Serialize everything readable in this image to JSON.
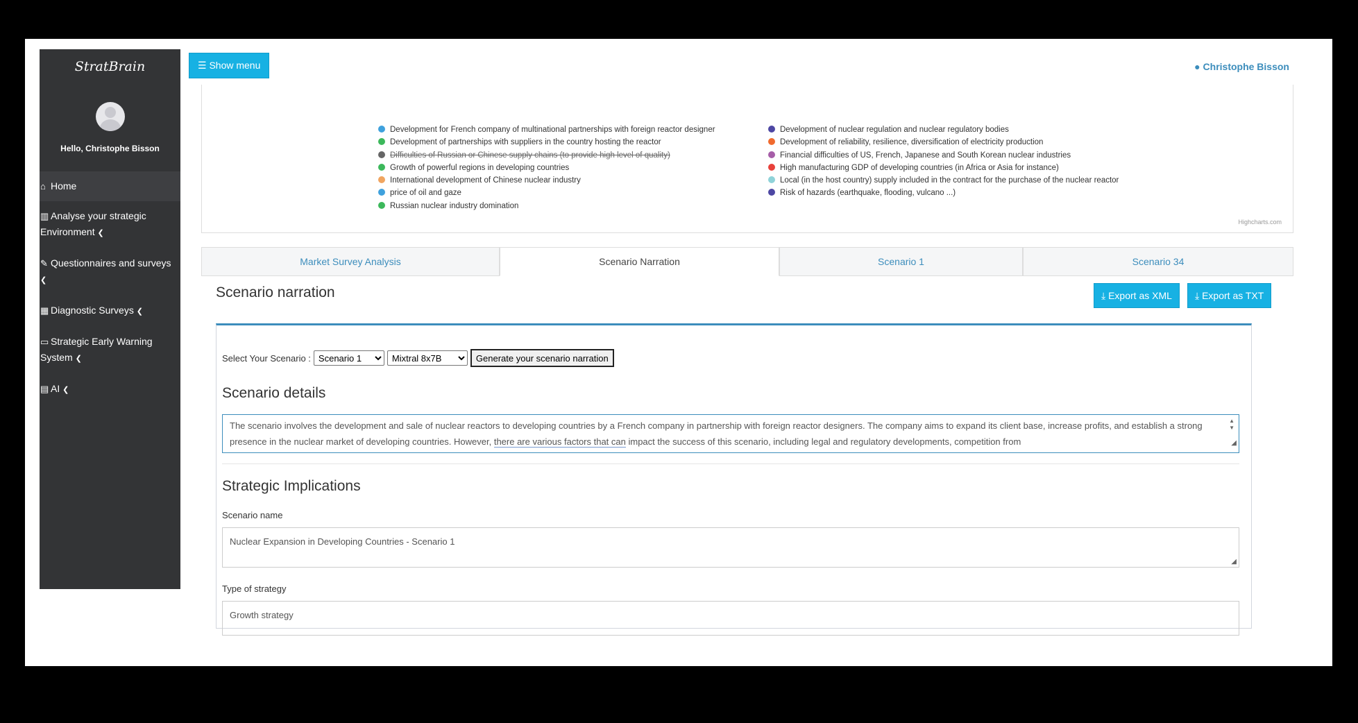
{
  "sidebar": {
    "brand": "StratBrain",
    "greeting": "Hello, Christophe Bisson",
    "items": [
      {
        "icon": "home-icon",
        "label": "Home"
      },
      {
        "icon": "chart-icon",
        "label": "Analyse your strategic Environment"
      },
      {
        "icon": "edit-icon",
        "label": "Questionnaires and surveys"
      },
      {
        "icon": "calendar-icon",
        "label": "Diagnostic Surveys"
      },
      {
        "icon": "laptop-icon",
        "label": "Strategic Early Warning System"
      },
      {
        "icon": "calculator-icon",
        "label": "AI"
      }
    ]
  },
  "header": {
    "show_menu": "Show menu",
    "user_name": "Christophe Bisson"
  },
  "legend": {
    "left": [
      {
        "label": "Development for French company of multinational partnerships with foreign reactor designer",
        "color": "#3fa1dd"
      },
      {
        "label": "Development of partnerships with suppliers in the country hosting the reactor",
        "color": "#3cb85b"
      },
      {
        "label": "Difficulties of Russian or Chinese supply chains (to provide high level of quality)",
        "color": "#666666",
        "hidden": true
      },
      {
        "label": "Growth of powerful regions in developing countries",
        "color": "#3cb85b"
      },
      {
        "label": "International development of Chinese nuclear industry",
        "color": "#f0a560"
      },
      {
        "label": "price of oil and gaze",
        "color": "#3fa1dd"
      },
      {
        "label": "Russian nuclear industry domination",
        "color": "#3cb85b"
      }
    ],
    "right": [
      {
        "label": "Development of nuclear regulation and nuclear regulatory bodies",
        "color": "#4d47a3"
      },
      {
        "label": "Development of reliability, resilience, diversification of electricity production",
        "color": "#f06a2e"
      },
      {
        "label": "Financial difficulties of US, French, Japanese and South Korean nuclear industries",
        "color": "#a65ea8"
      },
      {
        "label": "High manufacturing GDP of developing countries (in Africa or Asia for instance)",
        "color": "#e8413b"
      },
      {
        "label": "Local (in the host country) supply included in the contract for the purchase of the nuclear reactor",
        "color": "#8fd3d9"
      },
      {
        "label": "Risk of hazards (earthquake, flooding, vulcano ...)",
        "color": "#4d47a3"
      }
    ],
    "credits": "Highcharts.com"
  },
  "tabs": [
    {
      "label": "Market Survey Analysis"
    },
    {
      "label": "Scenario Narration",
      "active": true
    },
    {
      "label": "Scenario 1"
    },
    {
      "label": "Scenario 34"
    }
  ],
  "main": {
    "title": "Scenario narration",
    "export_xml": "Export as XML",
    "export_txt": "Export as TXT",
    "select_label": "Select Your Scenario :",
    "scenario_selected": "Scenario 1",
    "model_selected": "Mixtral 8x7B",
    "generate_label": "Generate your scenario narration",
    "details_heading": "Scenario details",
    "details_text_1": "The scenario involves the development and sale of nuclear reactors to developing countries by a French company in partnership with foreign reactor designers. The company aims to expand its client base, increase profits, and establish a strong presence in the nuclear market of developing countries. However, ",
    "details_text_2": "there are various factors that can",
    "details_text_3": " impact the success of this scenario, including legal and regulatory developments, competition from",
    "implications_heading": "Strategic Implications",
    "scenario_name_label": "Scenario name",
    "scenario_name_value": "Nuclear Expansion in Developing Countries - Scenario 1",
    "strategy_type_label": "Type of strategy",
    "strategy_type_value": "Growth strategy"
  },
  "colors": {
    "sidebar_bg": "#333436",
    "accent": "#17b1e3",
    "link": "#3c8dbc"
  }
}
